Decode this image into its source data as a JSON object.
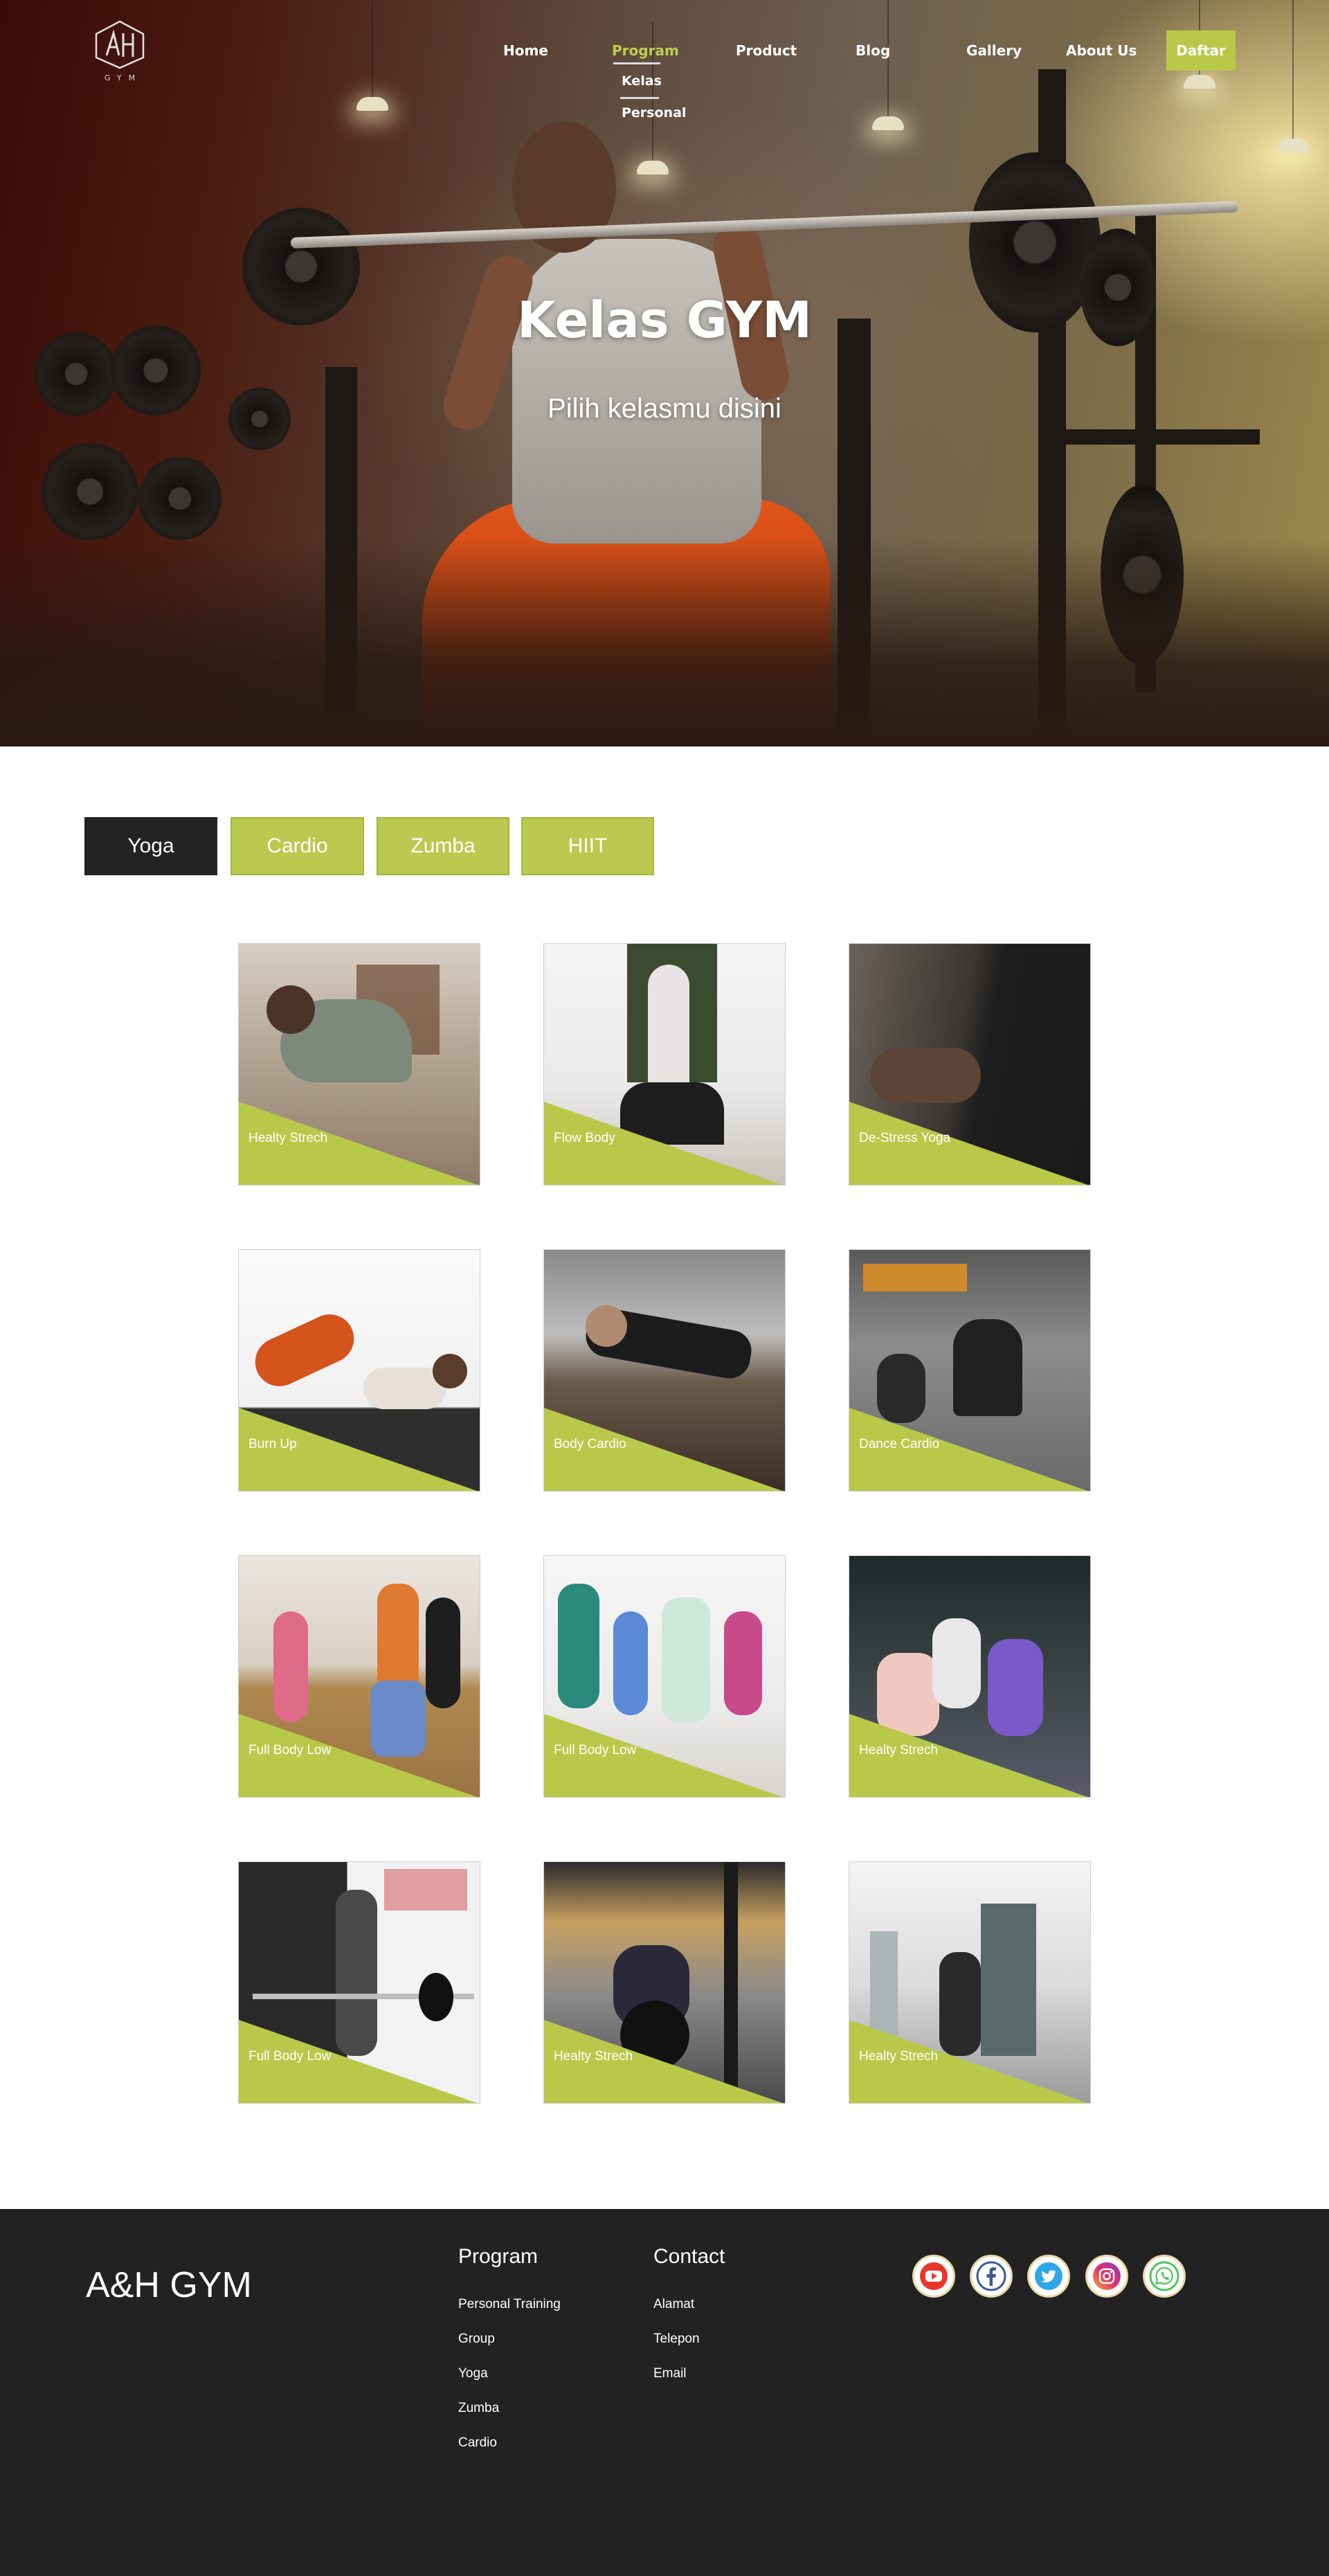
{
  "brand": {
    "logo_text": "A·H",
    "logo_sub": "GYM"
  },
  "nav": {
    "home": "Home",
    "program": "Program",
    "program_sub": [
      "Kelas",
      "Personal"
    ],
    "product": "Product",
    "blog": "Blog",
    "gallery": "Gallery",
    "about": "About Us",
    "cta": "Daftar"
  },
  "hero": {
    "title": "Kelas GYM",
    "subtitle": "Pilih kelasmu disini"
  },
  "tabs": [
    {
      "label": "Yoga",
      "active": true
    },
    {
      "label": "Cardio",
      "active": false
    },
    {
      "label": "Zumba",
      "active": false
    },
    {
      "label": "HIIT",
      "active": false
    }
  ],
  "classes": [
    {
      "name": "Healty Strech"
    },
    {
      "name": "Flow Body"
    },
    {
      "name": "De-Stress Yoga"
    },
    {
      "name": "Burn Up"
    },
    {
      "name": "Body Cardio"
    },
    {
      "name": "Dance Cardio"
    },
    {
      "name": "Full Body Low"
    },
    {
      "name": "Full Body Low"
    },
    {
      "name": "Healty Strech"
    },
    {
      "name": "Full Body Low"
    },
    {
      "name": "Healty Strech"
    },
    {
      "name": "Healty Strech"
    }
  ],
  "footer": {
    "brand": "A&H GYM",
    "program_title": "Program",
    "program_links": [
      "Personal Training",
      "Group",
      "Yoga",
      "Zumba",
      "Cardio"
    ],
    "contact_title": "Contact",
    "contact_links": [
      "Alamat",
      "Telepon",
      "Email"
    ],
    "social_icons": [
      "youtube-icon",
      "facebook-icon",
      "twitter-icon",
      "instagram-icon",
      "whatsapp-icon"
    ]
  },
  "colors": {
    "accent": "#b8c94a",
    "dark": "#222222",
    "footer_bg": "#222222",
    "tab_active": "#232323"
  }
}
